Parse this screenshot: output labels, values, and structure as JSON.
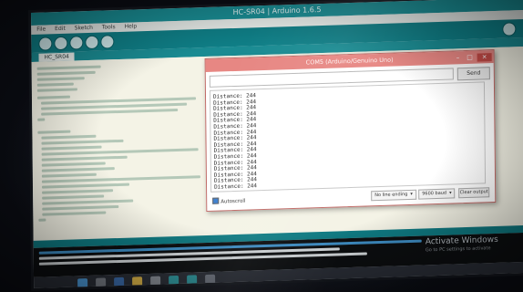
{
  "ide": {
    "window_title": "HC-SR04 | Arduino 1.6.5",
    "tab_name": "HC_SR04",
    "menu": [
      "File",
      "Edit",
      "Sketch",
      "Tools",
      "Help"
    ]
  },
  "serial_monitor": {
    "title": "COM5 (Arduino/Genuino Uno)",
    "send_label": "Send",
    "input_value": "",
    "output_lines": [
      "Distance: 244",
      "Distance: 244",
      "Distance: 244",
      "Distance: 244",
      "Distance: 244",
      "Distance: 244",
      "Distance: 244",
      "Distance: 244",
      "Distance: 244",
      "Distance: 244",
      "Distance: 244",
      "Distance: 244",
      "Distance: 244",
      "Distance: 244",
      "Distance: 244",
      "Distance: 244"
    ],
    "autoscroll_label": "Autoscroll",
    "line_ending": "No line ending",
    "baud": "9600 baud",
    "clear_label": "Clear output"
  },
  "watermark": {
    "title": "Activate Windows",
    "subtitle": "Go to PC settings to activate"
  },
  "colors": {
    "arduino_teal": "#0f7e86",
    "serial_title": "#e78783",
    "editor_bg": "#f4f3e6"
  }
}
